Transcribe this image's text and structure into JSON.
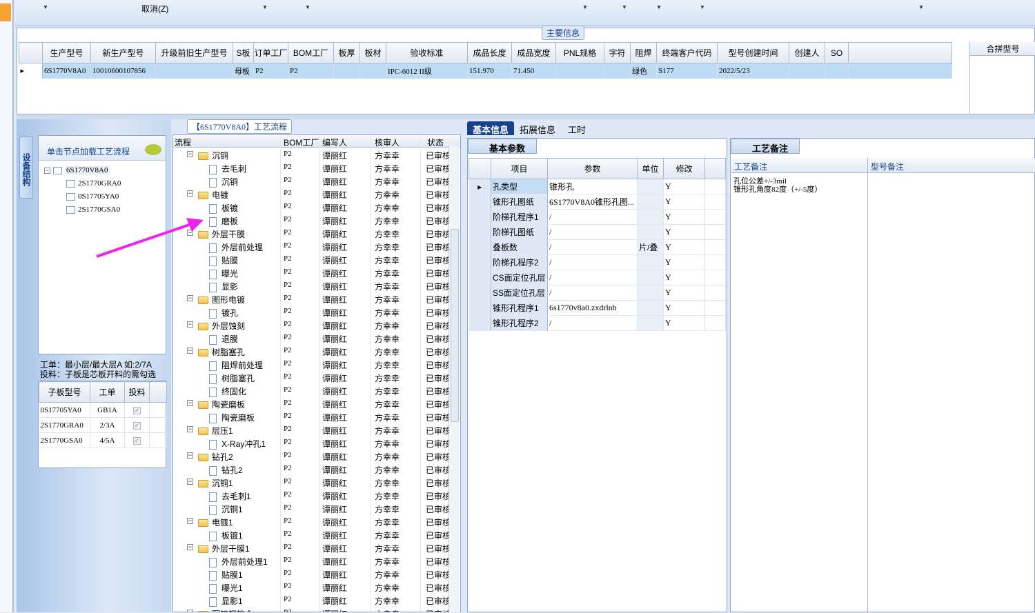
{
  "toolbar": {
    "cancel_label": "取消(Z)"
  },
  "main": {
    "title": "主要信息",
    "columns": [
      "生产型号",
      "新生产型号",
      "升级前旧生产型号",
      "S板",
      "订单工厂",
      "BOM工厂",
      "板厚",
      "板材",
      "验收标准",
      "成品长度",
      "成品宽度",
      "PNL规格",
      "字符",
      "阻焊",
      "终端客户代码",
      "型号创建时间",
      "创建人",
      "SO"
    ],
    "row": [
      "6S1770V8A0",
      "10010600107856",
      "",
      "母板",
      "P2",
      "P2",
      "",
      "",
      "IPC-6012 II级",
      "151.970",
      "71.450",
      "",
      "",
      "绿色",
      "S177",
      "2022/5/23",
      "",
      ""
    ],
    "merge_header": "合拼型号"
  },
  "left": {
    "vtab": "设备结构",
    "load_header": "单击节点加载工艺流程",
    "tree": [
      "6S1770V8A0",
      "2S1770GRA0",
      "0S17705YA0",
      "2S1770GSA0"
    ],
    "hint1": "工单：最小层/最大层A 如:2/7A",
    "hint2": "投料：子板是芯板开料的需勾选",
    "sub_cols": [
      "子板型号",
      "工单",
      "投料"
    ],
    "sub_rows": [
      [
        "0S17705YA0",
        "GB1A",
        "✓"
      ],
      [
        "2S1770GRA0",
        "2/3A",
        "✓"
      ],
      [
        "2S1770GSA0",
        "4/5A",
        "✓"
      ]
    ]
  },
  "process": {
    "title": "【6S1770V8A0】工艺流程",
    "cols": [
      "流程",
      "BOM工厂",
      "编写人",
      "核审人",
      "状态"
    ],
    "rows": [
      {
        "n": "沉铜",
        "lvl": 0
      },
      {
        "n": "去毛刺",
        "lvl": 1
      },
      {
        "n": "沉铜",
        "lvl": 1
      },
      {
        "n": "电镀",
        "lvl": 0
      },
      {
        "n": "板镀",
        "lvl": 1
      },
      {
        "n": "磨板",
        "lvl": 1
      },
      {
        "n": "外层干膜",
        "lvl": 0
      },
      {
        "n": "外层前处理",
        "lvl": 1
      },
      {
        "n": "贴膜",
        "lvl": 1
      },
      {
        "n": "曝光",
        "lvl": 1
      },
      {
        "n": "显影",
        "lvl": 1
      },
      {
        "n": "图形电镀",
        "lvl": 0
      },
      {
        "n": "镀孔",
        "lvl": 1
      },
      {
        "n": "外层蚀刻",
        "lvl": 0
      },
      {
        "n": "退膜",
        "lvl": 1
      },
      {
        "n": "树脂塞孔",
        "lvl": 0
      },
      {
        "n": "阻焊前处理",
        "lvl": 1
      },
      {
        "n": "树脂塞孔",
        "lvl": 1
      },
      {
        "n": "终固化",
        "lvl": 1
      },
      {
        "n": "陶瓷磨板",
        "lvl": 0
      },
      {
        "n": "陶瓷磨板",
        "lvl": 1
      },
      {
        "n": "层压1",
        "lvl": 0
      },
      {
        "n": "X-Ray冲孔1",
        "lvl": 1
      },
      {
        "n": "钻孔2",
        "lvl": 0
      },
      {
        "n": "钻孔2",
        "lvl": 1
      },
      {
        "n": "沉铜1",
        "lvl": 0
      },
      {
        "n": "去毛刺1",
        "lvl": 1
      },
      {
        "n": "沉铜1",
        "lvl": 1
      },
      {
        "n": "电镀1",
        "lvl": 0
      },
      {
        "n": "板镀1",
        "lvl": 1
      },
      {
        "n": "外层干膜1",
        "lvl": 0
      },
      {
        "n": "外层前处理1",
        "lvl": 1
      },
      {
        "n": "贴膜1",
        "lvl": 1
      },
      {
        "n": "曝光1",
        "lvl": 1
      },
      {
        "n": "显影1",
        "lvl": 1
      },
      {
        "n": "图镀铜镍金",
        "lvl": 0
      }
    ],
    "bom": "P2",
    "writer": "谭丽红",
    "reviewer": "方幸幸",
    "status": "已审核"
  },
  "right": {
    "tabs": [
      "基本信息",
      "拓展信息",
      "工时"
    ],
    "basic_title": "基本参数",
    "param_cols": [
      "项目",
      "参数",
      "单位",
      "修改"
    ],
    "params": [
      [
        "孔类型",
        "锥形孔",
        "",
        "Y"
      ],
      [
        "锥形孔图纸",
        "6S1770V8A0锥形孔图...",
        "",
        "Y"
      ],
      [
        "阶梯孔程序1",
        "/",
        "",
        "Y"
      ],
      [
        "阶梯孔图纸",
        "/",
        "",
        "Y"
      ],
      [
        "叠板数",
        "/",
        "片/叠",
        "Y"
      ],
      [
        "阶梯孔程序2",
        "/",
        "",
        "Y"
      ],
      [
        "CS面定位孔层",
        "/",
        "",
        "Y"
      ],
      [
        "SS面定位孔层",
        "/",
        "",
        "Y"
      ],
      [
        "锥形孔程序1",
        "6s1770v8a0.zxdrlnb",
        "",
        "Y"
      ],
      [
        "锥形孔程序2",
        "/",
        "",
        "Y"
      ]
    ],
    "note_title": "工艺备注",
    "note_cols": [
      "工艺备注",
      "型号备注"
    ],
    "note_lines": [
      "孔位公差+/-3mil",
      "锥形孔角度82度（+/-5度）"
    ]
  }
}
